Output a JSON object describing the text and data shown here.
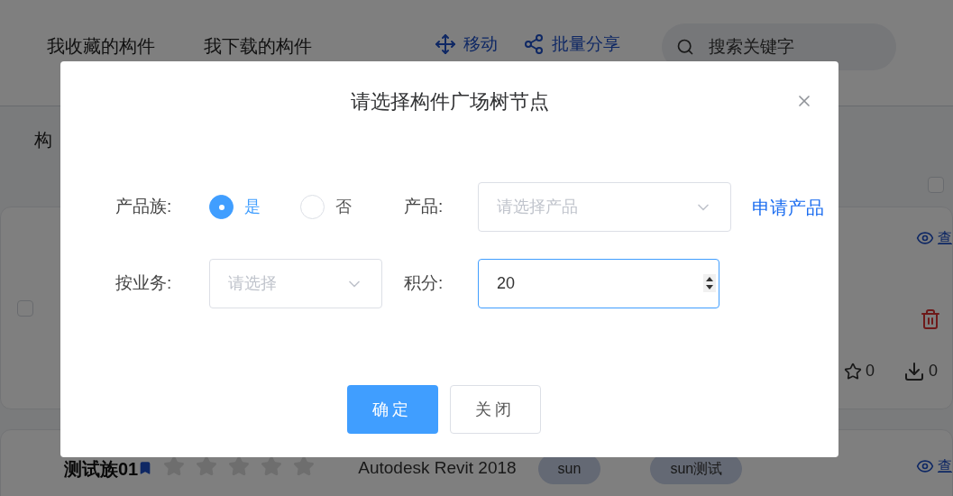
{
  "background": {
    "tabs": [
      {
        "label": "我收藏的构件"
      },
      {
        "label": "我下载的构件"
      }
    ],
    "actions": [
      {
        "kind": "move",
        "label": "移动"
      },
      {
        "kind": "share",
        "label": "批量分享"
      }
    ],
    "search": {
      "placeholder": "搜索关键字"
    },
    "section_title": "构",
    "select_all": {
      "checked": false
    },
    "cards": [
      {
        "kind": "detail",
        "checked": false,
        "view_link": "查",
        "like_count": "0",
        "download_count": "0"
      },
      {
        "kind": "summary",
        "title": "测试族01",
        "stars": 0,
        "software": "Autodesk Revit 2018",
        "tags": [
          "sun",
          "sun测试"
        ],
        "view_link": "查"
      }
    ]
  },
  "dialog": {
    "title": "请选择构件广场树节点",
    "family": {
      "label": "产品族:",
      "options": [
        {
          "label": "是",
          "selected": true
        },
        {
          "label": "否",
          "selected": false
        }
      ]
    },
    "product": {
      "label": "产品:",
      "placeholder": "请选择产品",
      "link": "申请产品"
    },
    "business": {
      "label": "按业务:",
      "placeholder": "请选择"
    },
    "points": {
      "label": "积分:",
      "value": "20"
    },
    "buttons": [
      {
        "kind": "primary",
        "label": "确定"
      },
      {
        "kind": "default",
        "label": "关闭"
      }
    ]
  }
}
